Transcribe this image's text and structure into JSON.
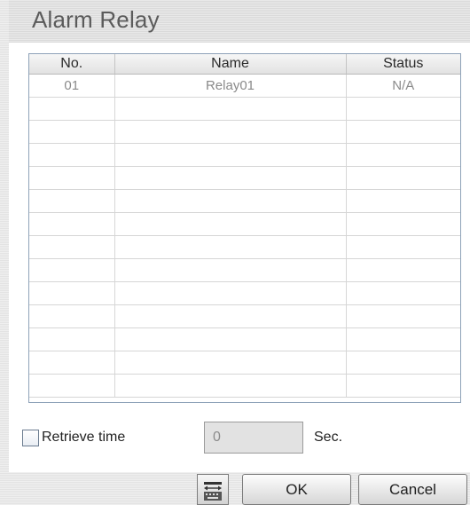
{
  "dialog": {
    "title": "Alarm Relay"
  },
  "table": {
    "columns": [
      "No.",
      "Name",
      "Status"
    ],
    "rows": [
      {
        "no": "01",
        "name": "Relay01",
        "status": "N/A"
      }
    ],
    "empty_row_count": 13
  },
  "retrieve": {
    "checkbox_label": "Retrieve time",
    "checked": false,
    "value": "0",
    "unit": "Sec."
  },
  "buttons": {
    "keyboard_icon": "keyboard-icon",
    "ok_label": "OK",
    "cancel_label": "Cancel"
  }
}
